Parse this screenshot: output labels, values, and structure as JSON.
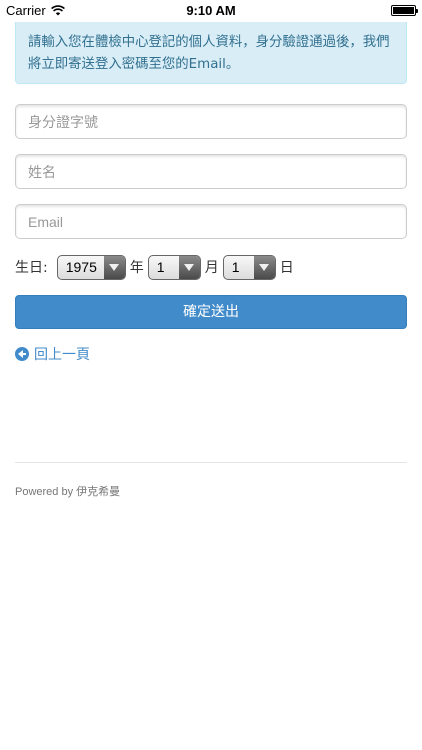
{
  "status_bar": {
    "carrier": "Carrier",
    "time": "9:10 AM"
  },
  "alert": {
    "message": "請輸入您在體檢中心登記的個人資料，身分驗證通過後，我們將立即寄送登入密碼至您的Email。"
  },
  "form": {
    "id_placeholder": "身分證字號",
    "name_placeholder": "姓名",
    "email_placeholder": "Email",
    "birthday_label": "生日:",
    "year_value": "1975",
    "year_unit": "年",
    "month_value": "1",
    "month_unit": "月",
    "day_value": "1",
    "day_unit": "日",
    "submit_label": "確定送出"
  },
  "nav": {
    "back_label": "回上一頁"
  },
  "footer": {
    "powered_by": "Powered by 伊克希曼"
  },
  "colors": {
    "primary": "#428bca",
    "alert_bg": "#d9edf7",
    "alert_text": "#31708f"
  },
  "icons": {
    "wifi": "wifi-icon",
    "battery": "battery-icon",
    "back": "circle-arrow-left-icon",
    "dropdown": "chevron-down-icon"
  }
}
